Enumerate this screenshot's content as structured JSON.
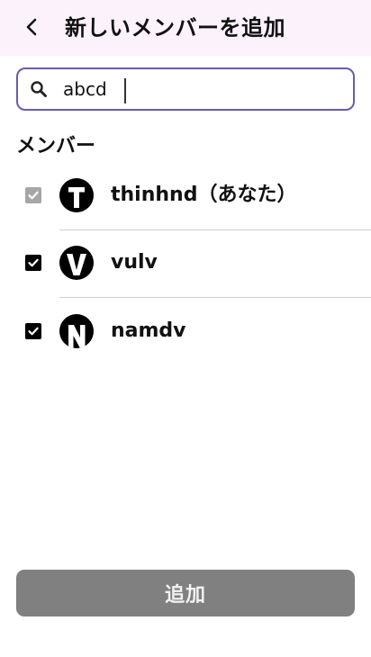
{
  "header": {
    "title": "新しいメンバーを追加",
    "back_icon": "chevron-left-icon"
  },
  "search": {
    "value": "abcd",
    "icon": "search-icon"
  },
  "members_section": {
    "label": "メンバー",
    "items": [
      {
        "name": "thinhnd（あなた）",
        "avatar_letter": "T",
        "checked": true,
        "disabled": true
      },
      {
        "name": "vulv",
        "avatar_letter": "V",
        "checked": true,
        "disabled": false
      },
      {
        "name": "namdv",
        "avatar_letter": "N",
        "checked": true,
        "disabled": false
      }
    ]
  },
  "footer": {
    "add_label": "追加"
  },
  "colors": {
    "header_bg": "#fbf2fb",
    "search_border": "#6a5ab0",
    "button_bg": "#808080",
    "checkbox_disabled": "#a6a6a6"
  }
}
